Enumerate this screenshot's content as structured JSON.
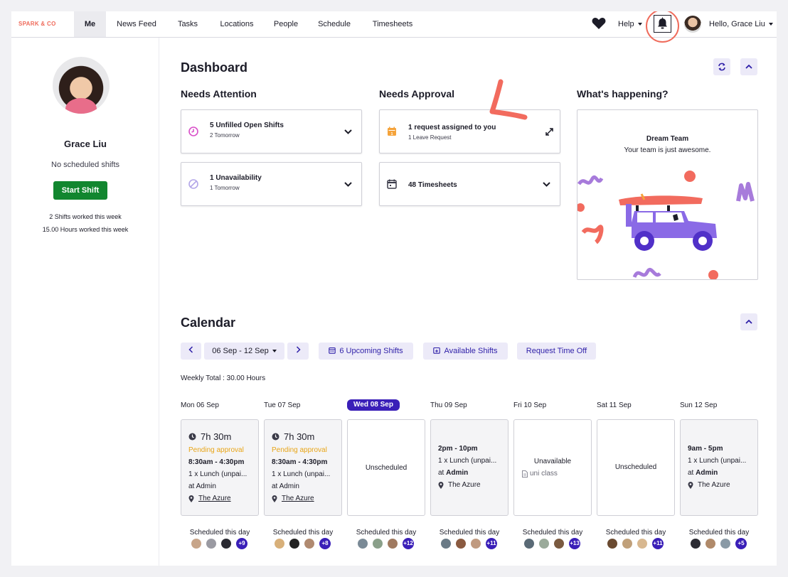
{
  "nav": {
    "logo": "SPARK & CO",
    "tabs": [
      "Me",
      "News Feed",
      "Tasks",
      "Locations",
      "People",
      "Schedule",
      "Timesheets"
    ],
    "help": "Help",
    "greeting": "Hello, Grace Liu"
  },
  "sidebar": {
    "name": "Grace Liu",
    "no_shifts": "No scheduled shifts",
    "start_shift": "Start Shift",
    "stat1": "2 Shifts worked this week",
    "stat2": "15.00 Hours worked this week"
  },
  "dashboard": {
    "title": "Dashboard",
    "needs_attention": {
      "title": "Needs Attention",
      "cards": [
        {
          "title": "5 Unfilled Open Shifts",
          "sub": "2 Tomorrow"
        },
        {
          "title": "1 Unavailability",
          "sub": "1 Tomorrow"
        }
      ]
    },
    "needs_approval": {
      "title": "Needs Approval",
      "cards": [
        {
          "title": "1 request assigned to you",
          "sub": "1 Leave Request"
        },
        {
          "title": "48 Timesheets"
        }
      ]
    },
    "whats_happening": {
      "title": "What's happening?",
      "heading": "Dream Team",
      "text": "Your team is just awesome."
    }
  },
  "calendar": {
    "title": "Calendar",
    "range": "06 Sep - 12 Sep",
    "upcoming": "6 Upcoming Shifts",
    "available": "Available Shifts",
    "request_off": "Request Time Off",
    "weekly_total": "Weekly Total : 30.00 Hours",
    "days": [
      {
        "label": "Mon 06 Sep",
        "duration": "7h 30m",
        "status": "Pending approval",
        "time": "8:30am - 4:30pm",
        "break": "1 x Lunch (unpai...",
        "at": "at Admin",
        "location": "The Azure",
        "scheduled": "Scheduled this day",
        "more": "+9"
      },
      {
        "label": "Tue 07 Sep",
        "duration": "7h 30m",
        "status": "Pending approval",
        "time": "8:30am - 4:30pm",
        "break": "1 x Lunch (unpai...",
        "at": "at Admin",
        "location": "The Azure",
        "scheduled": "Scheduled this day",
        "more": "+8"
      },
      {
        "label": "Wed 08 Sep",
        "text": "Unscheduled",
        "scheduled": "Scheduled this day",
        "more": "+12"
      },
      {
        "label": "Thu 09 Sep",
        "time": "2pm - 10pm",
        "break": "1 x Lunch (unpai...",
        "at_prefix": "at",
        "at_bold": "Admin",
        "location": "The Azure",
        "scheduled": "Scheduled this day",
        "more": "+11"
      },
      {
        "label": "Fri 10 Sep",
        "text": "Unavailable",
        "note": "uni class",
        "scheduled": "Scheduled this day",
        "more": "+13"
      },
      {
        "label": "Sat 11 Sep",
        "text": "Unscheduled",
        "scheduled": "Scheduled this day",
        "more": "+11"
      },
      {
        "label": "Sun 12 Sep",
        "time": "9am - 5pm",
        "break": "1 x Lunch (unpai...",
        "at_prefix": "at",
        "at_bold": "Admin",
        "location": "The Azure",
        "scheduled": "Scheduled this day",
        "more": "+5"
      }
    ]
  },
  "colors": {
    "accent": "#3a1fb8",
    "pending": "#e8a517",
    "start": "#12862f",
    "annotation": "#ef6b5b"
  }
}
